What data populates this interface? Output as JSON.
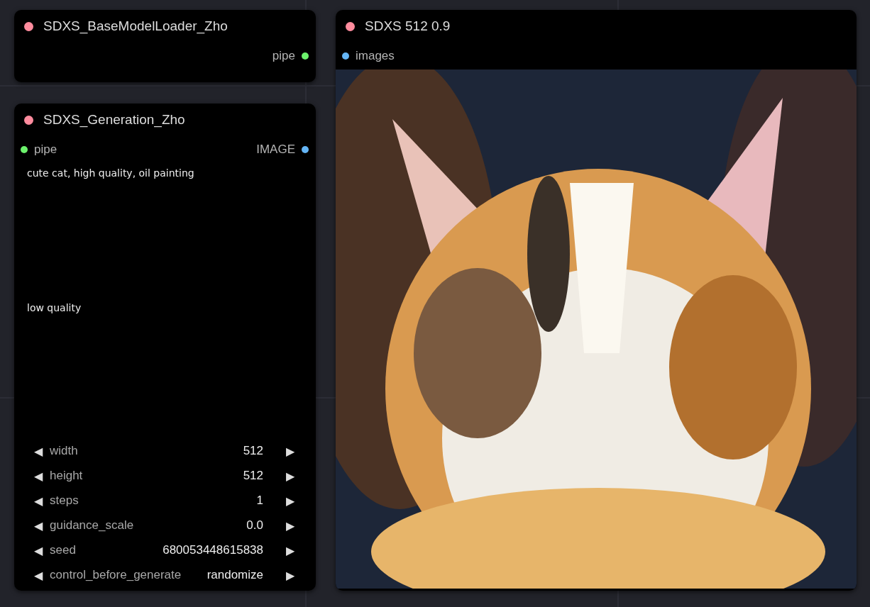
{
  "nodes": [
    {
      "title": "SDXS_BaseModelLoader_Zho",
      "outputs": [
        {
          "label": "pipe",
          "color": "#6cf26c"
        }
      ]
    },
    {
      "title": "SDXS_Generation_Zho",
      "inputs": [
        {
          "label": "pipe",
          "color": "#6cf26c"
        }
      ],
      "outputs": [
        {
          "label": "IMAGE",
          "color": "#64b5f6"
        }
      ],
      "prompts": [
        {
          "value": "cute cat, high quality, oil painting"
        },
        {
          "value": "low quality"
        }
      ],
      "widgets": [
        {
          "decrement": "◀",
          "name": "width",
          "value": "512",
          "increment": "▶"
        },
        {
          "decrement": "◀",
          "name": "height",
          "value": "512",
          "increment": "▶"
        },
        {
          "decrement": "◀",
          "name": "steps",
          "value": "1",
          "increment": "▶"
        },
        {
          "decrement": "◀",
          "name": "guidance_scale",
          "value": "0.0",
          "increment": "▶"
        },
        {
          "decrement": "◀",
          "name": "seed",
          "value": "680053448615838",
          "increment": "▶"
        },
        {
          "decrement": "◀",
          "name": "control_before_generate",
          "value": "randomize",
          "increment": "▶"
        }
      ]
    }
  ],
  "preview": {
    "title": "SDXS 512 0.9",
    "inputs": [
      {
        "label": "images",
        "color": "#64b5f6"
      }
    ]
  }
}
